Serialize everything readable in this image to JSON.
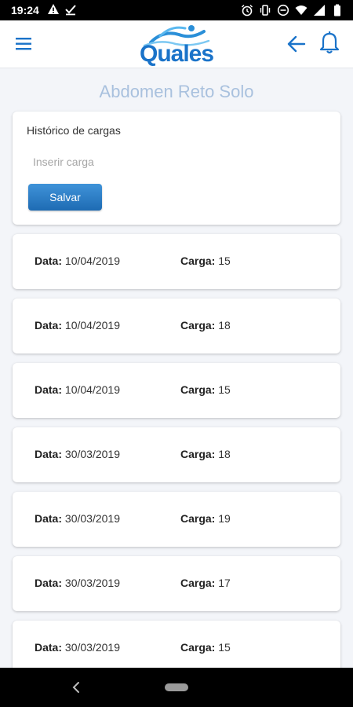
{
  "status_bar": {
    "time": "19:24",
    "left_icons": [
      "warning-icon",
      "download-done-icon"
    ],
    "right_icons": [
      "alarm-icon",
      "vibrate-icon",
      "do-not-disturb-icon",
      "wifi-icon",
      "signal-icon",
      "battery-icon"
    ]
  },
  "header": {
    "logo_text": "Quales",
    "brand_color": "#1a73c9",
    "menu_icon": "menu-icon",
    "back_icon": "arrow-back-icon",
    "notification_icon": "bell-icon"
  },
  "page": {
    "title": "Abdomen Reto Solo"
  },
  "form": {
    "label": "Histórico de cargas",
    "input_placeholder": "Inserir carga",
    "input_value": "",
    "save_label": "Salvar"
  },
  "records": [
    {
      "date_label": "Data:",
      "date": "10/04/2019",
      "load_label": "Carga:",
      "load": "15"
    },
    {
      "date_label": "Data:",
      "date": "10/04/2019",
      "load_label": "Carga:",
      "load": "18"
    },
    {
      "date_label": "Data:",
      "date": "10/04/2019",
      "load_label": "Carga:",
      "load": "15"
    },
    {
      "date_label": "Data:",
      "date": "30/03/2019",
      "load_label": "Carga:",
      "load": "18"
    },
    {
      "date_label": "Data:",
      "date": "30/03/2019",
      "load_label": "Carga:",
      "load": "19"
    },
    {
      "date_label": "Data:",
      "date": "30/03/2019",
      "load_label": "Carga:",
      "load": "17"
    },
    {
      "date_label": "Data:",
      "date": "30/03/2019",
      "load_label": "Carga:",
      "load": "15"
    }
  ],
  "nav_bar": {
    "back_icon": "nav-back-icon",
    "home_icon": "nav-home-pill-icon"
  }
}
